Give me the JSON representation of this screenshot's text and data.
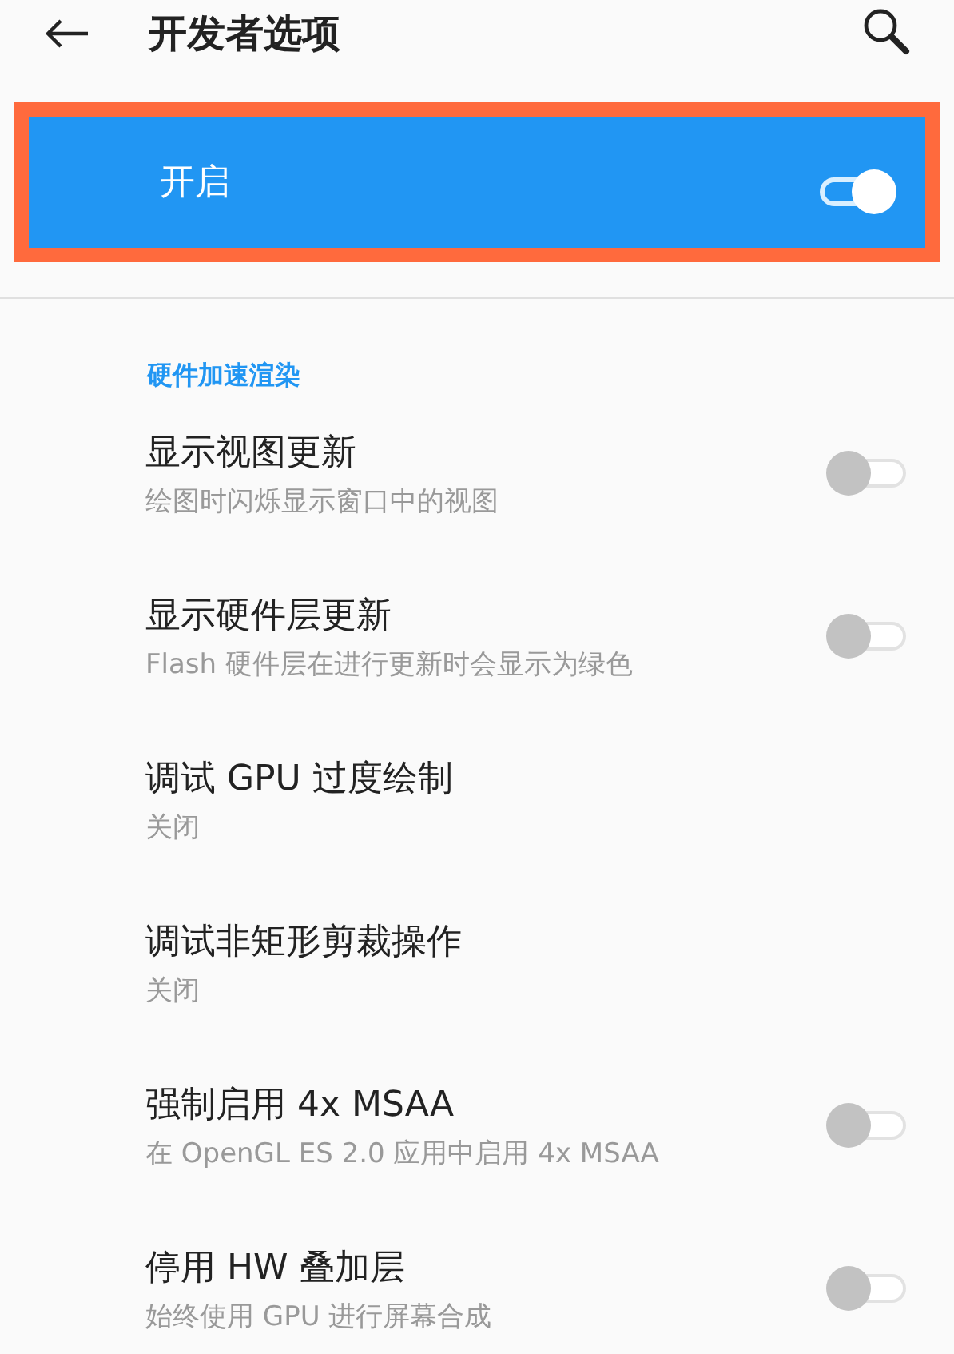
{
  "header": {
    "title": "开发者选项"
  },
  "master_switch": {
    "label": "开启",
    "on": true,
    "highlighted": true
  },
  "section": {
    "title": "硬件加速渲染"
  },
  "items": [
    {
      "kind": "toggle",
      "title": "显示视图更新",
      "summary": "绘图时闪烁显示窗口中的视图",
      "on": false
    },
    {
      "kind": "toggle",
      "title": "显示硬件层更新",
      "summary": "Flash 硬件层在进行更新时会显示为绿色",
      "on": false
    },
    {
      "kind": "value",
      "title": "调试 GPU 过度绘制",
      "summary": "关闭"
    },
    {
      "kind": "value",
      "title": "调试非矩形剪裁操作",
      "summary": "关闭"
    },
    {
      "kind": "toggle",
      "title": "强制启用 4x MSAA",
      "summary": "在 OpenGL ES 2.0 应用中启用 4x MSAA",
      "on": false
    },
    {
      "kind": "toggle",
      "title": "停用 HW 叠加层",
      "summary": "始终使用 GPU 进行屏幕合成",
      "on": false
    }
  ]
}
